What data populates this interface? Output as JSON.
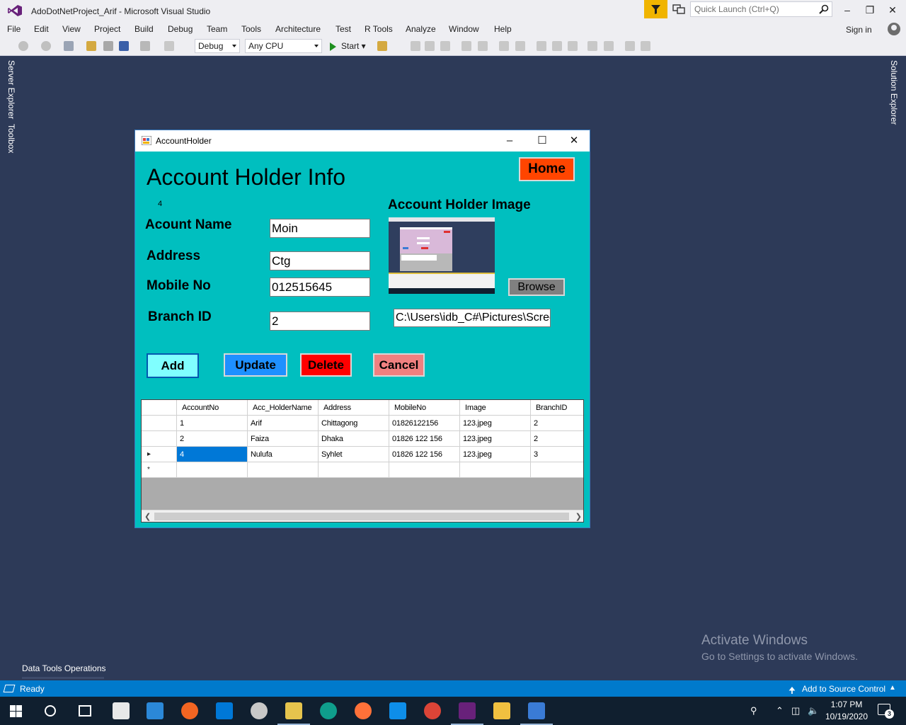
{
  "vs": {
    "title": "AdoDotNetProject_Arif - Microsoft Visual Studio",
    "quick_launch_placeholder": "Quick Launch (Ctrl+Q)",
    "menu": [
      "File",
      "Edit",
      "View",
      "Project",
      "Build",
      "Debug",
      "Team",
      "Tools",
      "Architecture",
      "Test",
      "R Tools",
      "Analyze",
      "Window",
      "Help"
    ],
    "sign_in": "Sign in",
    "toolbar": {
      "config": "Debug",
      "platform": "Any CPU",
      "start": "Start"
    },
    "side_left": [
      "Server Explorer",
      "Toolbox"
    ],
    "side_right": "Solution Explorer",
    "data_tools_tab": "Data Tools Operations",
    "status": {
      "ready": "Ready",
      "source_control": "Add to Source Control"
    }
  },
  "watermark": {
    "line1": "Activate Windows",
    "line2": "Go to Settings to activate Windows."
  },
  "taskbar": {
    "time": "1:07 PM",
    "date": "10/19/2020",
    "notifications": "3"
  },
  "form": {
    "window_title": "AccountHolder",
    "heading": "Account Holder Info",
    "hidden_id": "4",
    "labels": {
      "name": "Acount Name",
      "address": "Address",
      "mobile": "Mobile No",
      "branch": "Branch ID",
      "image": "Account Holder Image"
    },
    "values": {
      "name": "Moin",
      "address": "Ctg",
      "mobile": "012515645",
      "branch": "2",
      "image_path": "C:\\Users\\idb_C#\\Pictures\\Scree"
    },
    "buttons": {
      "home": "Home",
      "browse": "Browse",
      "add": "Add",
      "update": "Update",
      "delete": "Delete",
      "cancel": "Cancel"
    },
    "grid": {
      "columns": [
        "AccountNo",
        "Acc_HolderName",
        "Address",
        "MobileNo",
        "Image",
        "BranchID"
      ],
      "rows": [
        [
          "1",
          "Arif",
          "Chittagong",
          "01826122156",
          "123.jpeg",
          "2"
        ],
        [
          "2",
          "Faiza",
          "Dhaka",
          "01826 122 156",
          "123.jpeg",
          "2"
        ],
        [
          "4",
          "Nulufa",
          "Syhlet",
          "01826 122 156",
          "123.jpeg",
          "3"
        ]
      ],
      "new_row_marker": "*",
      "current_row_marker": "▸"
    }
  },
  "colors": {
    "form_bg": "#00bfbf",
    "vs_chrome": "#eeeef2",
    "status_bar": "#007acc",
    "desktop": "#2d3a58"
  }
}
